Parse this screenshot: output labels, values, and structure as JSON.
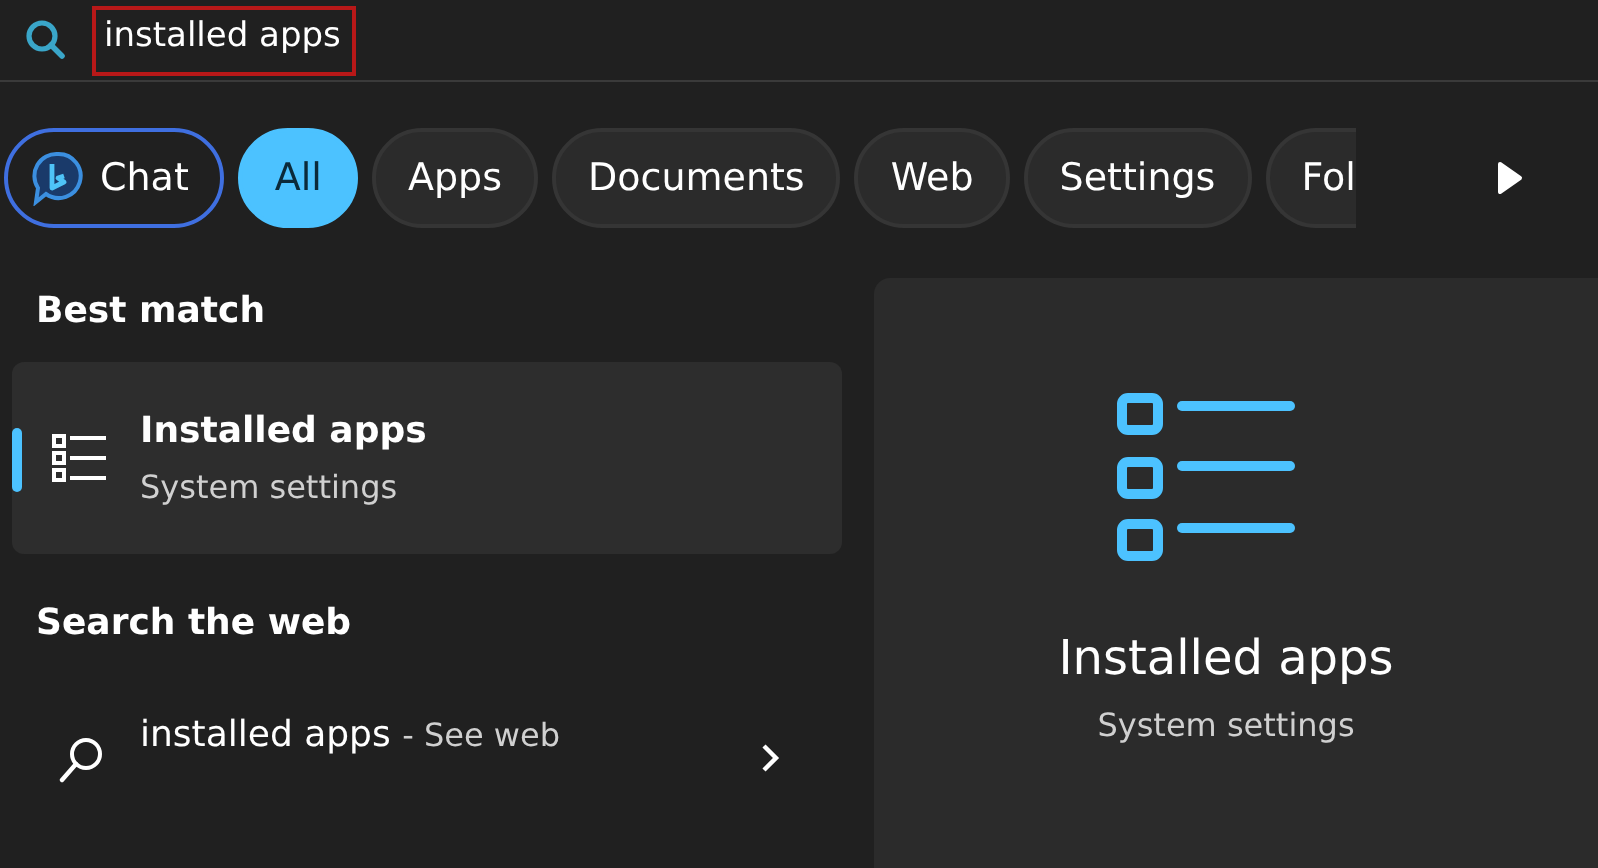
{
  "search": {
    "value": "installed apps",
    "highlighted": true
  },
  "filters": [
    {
      "label": "Chat",
      "kind": "chat",
      "selected": false
    },
    {
      "label": "All",
      "kind": "plain",
      "selected": true
    },
    {
      "label": "Apps",
      "kind": "plain",
      "selected": false
    },
    {
      "label": "Documents",
      "kind": "plain",
      "selected": false
    },
    {
      "label": "Web",
      "kind": "plain",
      "selected": false
    },
    {
      "label": "Settings",
      "kind": "plain",
      "selected": false
    },
    {
      "label": "Fol",
      "kind": "clipped",
      "selected": false
    }
  ],
  "best_match": {
    "heading": "Best match",
    "title": "Installed apps",
    "subtitle": "System settings",
    "selected": true
  },
  "web": {
    "heading": "Search the web",
    "query": "installed apps",
    "suffix": "- See web"
  },
  "preview": {
    "title": "Installed apps",
    "subtitle": "System settings"
  }
}
